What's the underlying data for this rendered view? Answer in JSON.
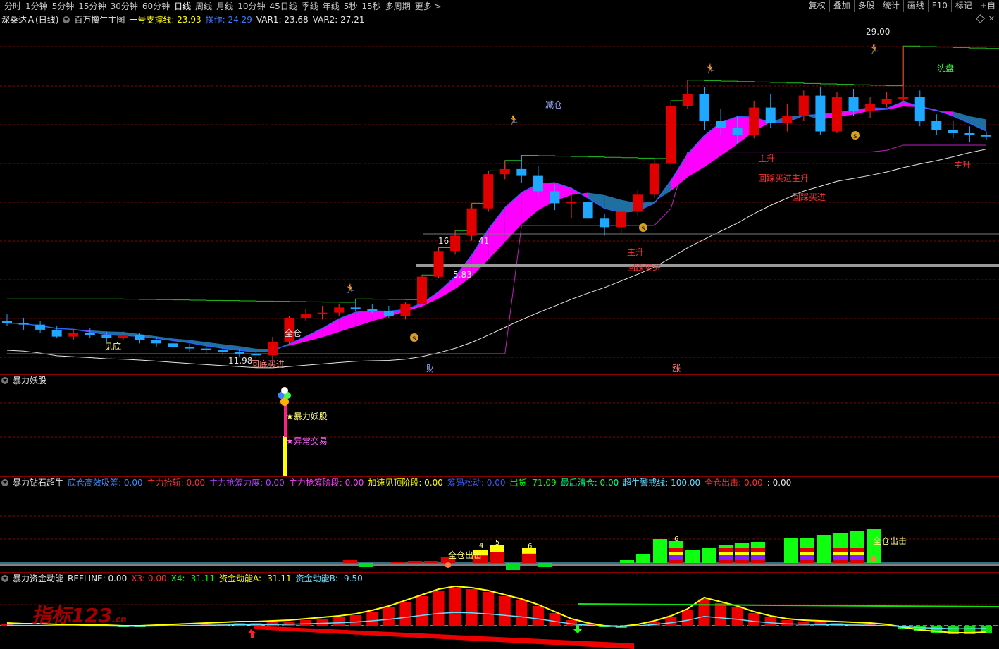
{
  "toolbar": {
    "timeframes": [
      "分时",
      "1分钟",
      "5分钟",
      "15分钟",
      "30分钟",
      "60分钟",
      "日线",
      "周线",
      "月线",
      "10分钟",
      "45日线",
      "季线",
      "年线",
      "5秒",
      "15秒",
      "多周期",
      "更多 >"
    ],
    "active": "日线",
    "tools": [
      "复权",
      "叠加",
      "多股",
      "统计",
      "画线",
      "F10",
      "标记",
      "+自"
    ]
  },
  "main_panel": {
    "stock": "深桑达Ａ",
    "period": "(日线)",
    "indicator_name": "百万擒牛主图",
    "values": [
      {
        "label": "一号支撑线:",
        "value": "23.93",
        "color": "#ffff00"
      },
      {
        "label": "操作:",
        "value": "24.29",
        "color": "#3a7cff"
      },
      {
        "label": "VAR1:",
        "value": "23.68",
        "color": "#e6e6e6"
      },
      {
        "label": "VAR2:",
        "value": "27.21",
        "color": "#e6e6e6"
      }
    ],
    "labels": {
      "high": "29.00",
      "low": "11.98",
      "jiancang": "减仓",
      "xipan": "洗盘",
      "jiandi": "见底",
      "quancang": "全仓",
      "huidi": "回底买进",
      "zhusheng1": "主升",
      "huicai1": "回踩买进",
      "zhusheng2": "主升",
      "zhusheng3": "主升",
      "huicai2": "回踩买进",
      "huicai3": "回踩买进",
      "zhusheng4": "主升",
      "v16": "16",
      "v41": "41",
      "v83": "5.83",
      "cai": "财",
      "zhang": "涨"
    }
  },
  "panel2": {
    "title": "暴力妖股",
    "labels": {
      "a": "★暴力妖股",
      "b": "★异常交易"
    }
  },
  "panel3": {
    "title": "暴力钻石超牛",
    "values": [
      {
        "label": "底仓高效吸筹:",
        "value": "0.00",
        "color": "#3a8cff"
      },
      {
        "label": "主力抬轿:",
        "value": "0.00",
        "color": "#ff3030"
      },
      {
        "label": "主力抢筹力度:",
        "value": "0.00",
        "color": "#b040ff"
      },
      {
        "label": "主力抢筹阶段:",
        "value": "0.00",
        "color": "#ff40ff"
      },
      {
        "label": "加速见顶阶段:",
        "value": "0.00",
        "color": "#ffff00"
      },
      {
        "label": "筹码松动:",
        "value": "0.00",
        "color": "#3a5cff"
      },
      {
        "label": "出货:",
        "value": "71.09",
        "color": "#00ff00"
      },
      {
        "label": "最后清仓:",
        "value": "0.00",
        "color": "#00ff80"
      },
      {
        "label": "超牛警戒线:",
        "value": "100.00",
        "color": "#60e0ff"
      },
      {
        "label": "全仓出击:",
        "value": "0.00",
        "color": "#ff3030"
      },
      {
        "label": ":",
        "value": "0.00",
        "color": "#e6e6e6"
      }
    ],
    "labels": {
      "quancang1": "全仓出击",
      "quancang2": "全仓出击",
      "n4": "4",
      "n5": "5",
      "n6a": "6",
      "n6b": "6"
    }
  },
  "panel4": {
    "title": "暴力资金动能",
    "values": [
      {
        "label": "REFLINE:",
        "value": "0.00",
        "color": "#e6e6e6"
      },
      {
        "label": "X3:",
        "value": "0.00",
        "color": "#ff3030"
      },
      {
        "label": "X4:",
        "value": "-31.11",
        "color": "#00ff00"
      },
      {
        "label": "资金动能A:",
        "value": "-31.11",
        "color": "#ffff00"
      },
      {
        "label": "资金动能B:",
        "value": "-9.50",
        "color": "#60e0ff"
      }
    ]
  },
  "watermark": {
    "text": "指标123",
    "suffix": ".cn"
  },
  "colors": {
    "up": "#e00000",
    "down": "#1ea8ff",
    "grid": "#8a0000",
    "ribbon_up": "#ff00ff",
    "ribbon_down": "#1f6fa0"
  },
  "candles": [
    [
      12.9,
      13.3,
      12.6,
      12.8
    ],
    [
      12.8,
      13.1,
      12.4,
      12.7
    ],
    [
      12.7,
      12.9,
      12.2,
      12.4
    ],
    [
      12.4,
      12.6,
      11.9,
      12.0
    ],
    [
      12.0,
      12.4,
      11.8,
      12.2
    ],
    [
      12.2,
      12.5,
      11.9,
      12.1
    ],
    [
      12.1,
      12.3,
      11.7,
      11.9
    ],
    [
      11.9,
      12.3,
      11.8,
      12.1
    ],
    [
      12.1,
      12.2,
      11.6,
      11.8
    ],
    [
      11.8,
      12.0,
      11.4,
      11.6
    ],
    [
      11.6,
      11.8,
      11.2,
      11.4
    ],
    [
      11.4,
      11.6,
      11.1,
      11.3
    ],
    [
      11.3,
      11.5,
      11.0,
      11.2
    ],
    [
      11.2,
      11.4,
      10.9,
      11.1
    ],
    [
      11.1,
      11.3,
      10.8,
      11.0
    ],
    [
      11.0,
      11.2,
      10.7,
      10.9
    ],
    [
      10.9,
      11.98,
      10.6,
      11.7
    ],
    [
      11.7,
      13.2,
      11.5,
      13.1
    ],
    [
      13.1,
      13.6,
      12.9,
      13.3
    ],
    [
      13.3,
      13.8,
      13.0,
      13.4
    ],
    [
      13.4,
      13.9,
      13.2,
      13.7
    ],
    [
      13.7,
      14.2,
      13.5,
      13.6
    ],
    [
      13.6,
      13.9,
      13.3,
      13.5
    ],
    [
      13.5,
      13.8,
      13.1,
      13.2
    ],
    [
      13.2,
      14.0,
      13.0,
      13.9
    ],
    [
      13.9,
      15.6,
      13.8,
      15.5
    ],
    [
      15.5,
      17.2,
      15.4,
      17.0
    ],
    [
      17.0,
      18.2,
      16.8,
      17.9
    ],
    [
      17.9,
      19.8,
      17.6,
      19.5
    ],
    [
      19.5,
      21.7,
      19.3,
      21.5
    ],
    [
      21.5,
      22.3,
      21.2,
      21.8
    ],
    [
      21.8,
      22.6,
      21.0,
      21.4
    ],
    [
      21.4,
      22.0,
      20.2,
      20.5
    ],
    [
      20.5,
      20.9,
      19.4,
      19.8
    ],
    [
      19.8,
      20.3,
      18.9,
      19.9
    ],
    [
      19.9,
      20.5,
      18.7,
      18.9
    ],
    [
      18.9,
      19.2,
      17.9,
      18.4
    ],
    [
      18.4,
      19.5,
      18.0,
      19.3
    ],
    [
      19.3,
      20.6,
      19.1,
      20.3
    ],
    [
      20.3,
      22.4,
      20.1,
      22.1
    ],
    [
      22.1,
      25.8,
      22.0,
      25.5
    ],
    [
      25.5,
      27.0,
      25.3,
      26.2
    ],
    [
      26.2,
      26.6,
      24.1,
      24.6
    ],
    [
      24.6,
      25.3,
      23.8,
      24.2
    ],
    [
      24.2,
      24.9,
      23.3,
      23.8
    ],
    [
      23.8,
      25.8,
      23.6,
      25.4
    ],
    [
      25.4,
      26.2,
      24.2,
      24.5
    ],
    [
      24.5,
      25.6,
      24.0,
      24.9
    ],
    [
      24.9,
      26.4,
      24.6,
      26.1
    ],
    [
      26.1,
      26.6,
      23.8,
      24.0
    ],
    [
      24.0,
      26.3,
      23.9,
      26.0
    ],
    [
      26.0,
      26.5,
      24.9,
      25.2
    ],
    [
      25.2,
      26.0,
      24.8,
      25.6
    ],
    [
      25.6,
      26.3,
      25.4,
      25.9
    ],
    [
      25.9,
      29.0,
      25.7,
      26.0
    ],
    [
      26.0,
      26.4,
      24.3,
      24.6
    ],
    [
      24.6,
      25.0,
      23.8,
      24.1
    ],
    [
      24.1,
      24.6,
      23.6,
      23.9
    ],
    [
      23.9,
      24.3,
      23.4,
      23.8
    ],
    [
      23.8,
      24.0,
      23.5,
      23.7
    ]
  ]
}
